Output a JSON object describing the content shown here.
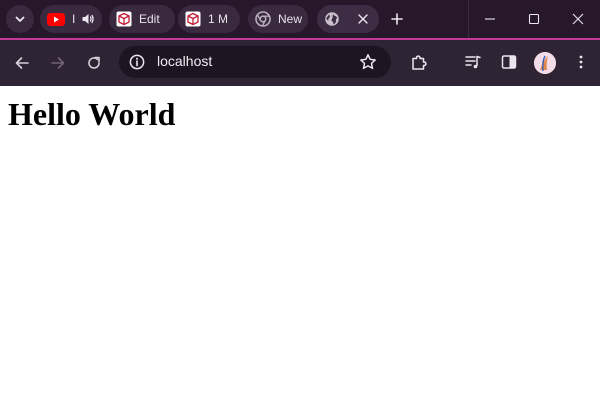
{
  "browser": {
    "tabs": [
      {
        "label": "I",
        "icon": "youtube-icon",
        "audio": true,
        "active": false
      },
      {
        "label": "Edit",
        "icon": "box-icon",
        "active": false
      },
      {
        "label": "1 M",
        "icon": "box-icon",
        "active": false
      },
      {
        "label": "New",
        "icon": "chrome-icon",
        "active": false
      },
      {
        "label": "",
        "icon": "globe-icon",
        "active": true
      }
    ],
    "address_bar": {
      "url": "localhost"
    },
    "colors": {
      "frame": "#26172b",
      "accent": "#c23a94",
      "toolbar": "#2f2434",
      "youtube": "#ff0000"
    }
  },
  "page": {
    "heading": "Hello World"
  }
}
